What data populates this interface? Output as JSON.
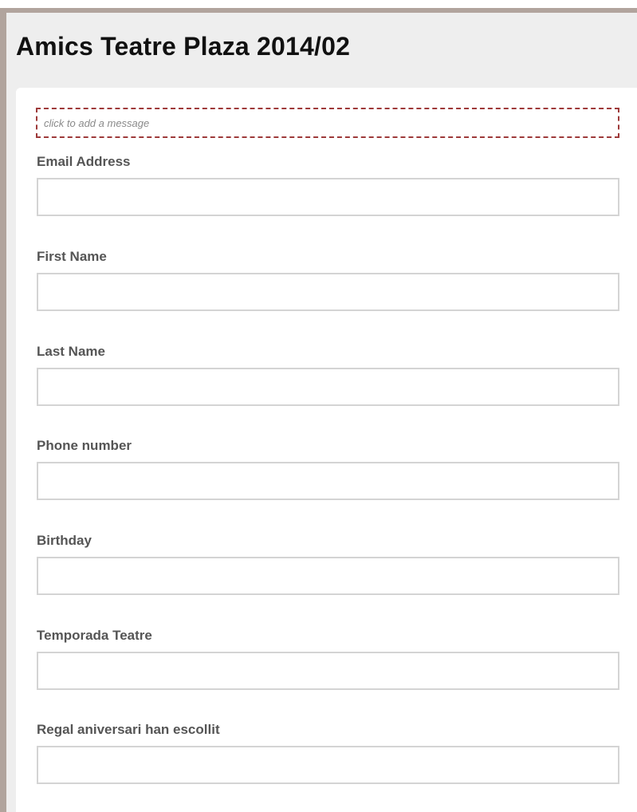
{
  "page": {
    "title": "Amics Teatre Plaza 2014/02"
  },
  "message": {
    "placeholder": "click to add a message"
  },
  "form": {
    "fields": [
      {
        "label": "Email Address",
        "value": ""
      },
      {
        "label": "First Name",
        "value": ""
      },
      {
        "label": "Last Name",
        "value": ""
      },
      {
        "label": "Phone number",
        "value": ""
      },
      {
        "label": "Birthday",
        "value": ""
      },
      {
        "label": "Temporada Teatre",
        "value": ""
      },
      {
        "label": "Regal aniversari han escollit",
        "value": ""
      }
    ]
  },
  "colors": {
    "frame": "#b1a49d",
    "header_bg": "#eeeeee",
    "message_border": "#9e3a3a",
    "label_text": "#555555",
    "input_border": "#d4d4d4"
  }
}
